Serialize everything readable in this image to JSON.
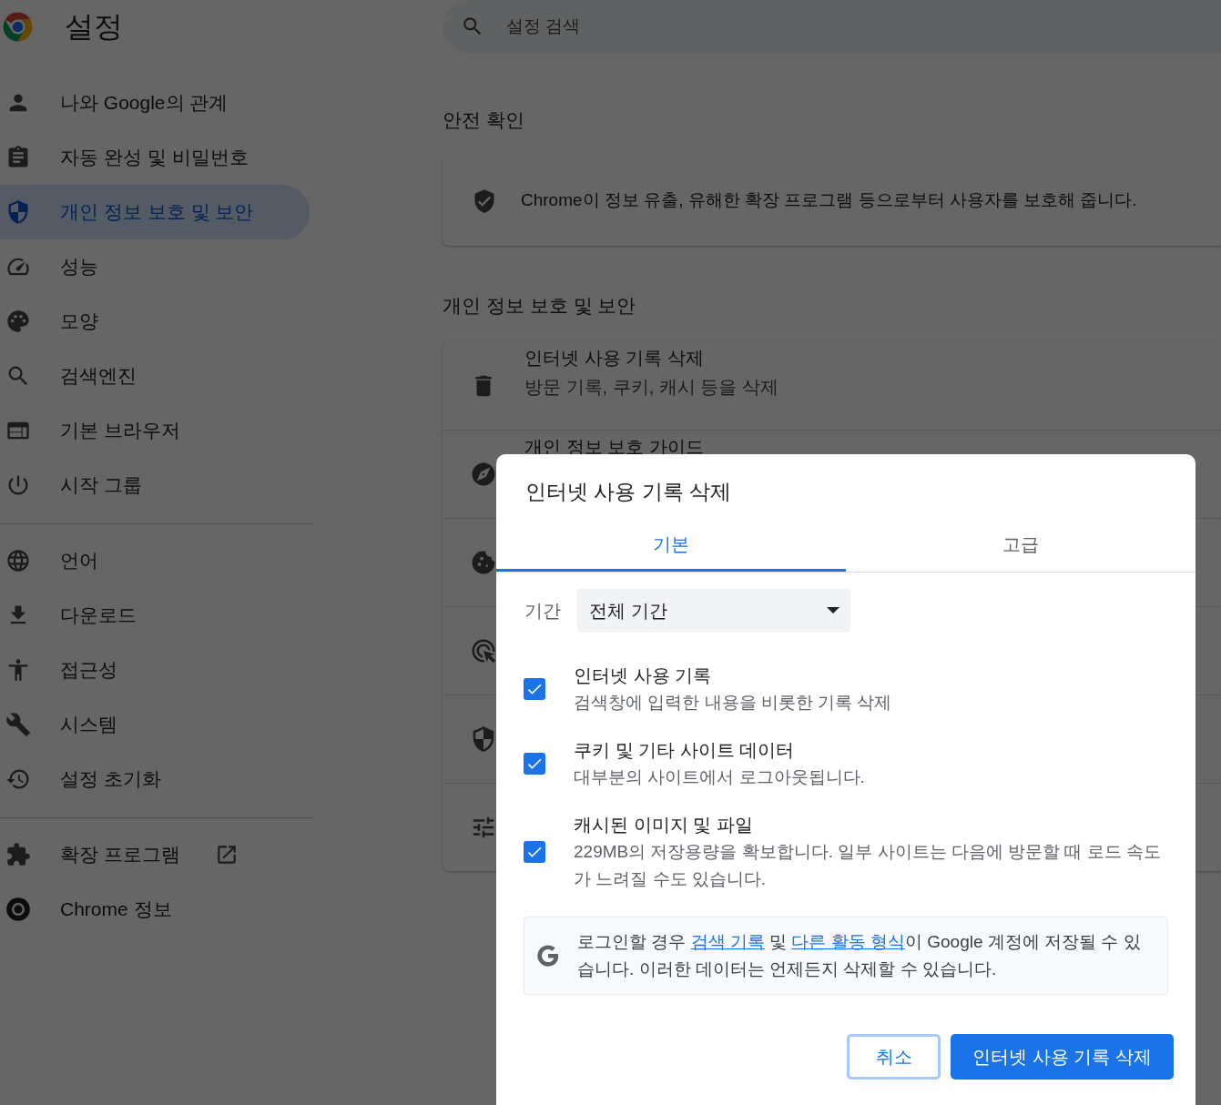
{
  "header": {
    "title": "설정",
    "search_placeholder": "설정 검색"
  },
  "sidebar": {
    "groups": [
      {
        "items": [
          {
            "label": "나와 Google의 관계",
            "selected": false,
            "external_link": false
          },
          {
            "label": "자동 완성 및 비밀번호",
            "selected": false,
            "external_link": false
          },
          {
            "label": "개인 정보 보호 및 보안",
            "selected": true,
            "external_link": false
          },
          {
            "label": "성능",
            "selected": false,
            "external_link": false
          },
          {
            "label": "모양",
            "selected": false,
            "external_link": false
          },
          {
            "label": "검색엔진",
            "selected": false,
            "external_link": false
          },
          {
            "label": "기본 브라우저",
            "selected": false,
            "external_link": false
          },
          {
            "label": "시작 그룹",
            "selected": false,
            "external_link": false
          }
        ]
      },
      {
        "items": [
          {
            "label": "언어",
            "selected": false,
            "external_link": false
          },
          {
            "label": "다운로드",
            "selected": false,
            "external_link": false
          },
          {
            "label": "접근성",
            "selected": false,
            "external_link": false
          },
          {
            "label": "시스템",
            "selected": false,
            "external_link": false
          },
          {
            "label": "설정 초기화",
            "selected": false,
            "external_link": false
          }
        ]
      },
      {
        "items": [
          {
            "label": "확장 프로그램",
            "selected": false,
            "external_link": true
          },
          {
            "label": "Chrome 정보",
            "selected": false,
            "external_link": false
          }
        ]
      }
    ]
  },
  "safety_check": {
    "heading": "안전 확인",
    "text": "Chrome이 정보 유출, 유해한 확장 프로그램 등으로부터 사용자를 보호해 줍니다."
  },
  "privacy": {
    "heading": "개인 정보 보호 및 보안",
    "rows": [
      {
        "title": "인터넷 사용 기록 삭제",
        "subtitle": "방문 기록, 쿠키, 캐시 등을 삭제"
      },
      {
        "title": "개인 정보 보호 가이드"
      },
      {},
      {},
      {},
      {}
    ]
  },
  "dialog": {
    "title": "인터넷 사용 기록 삭제",
    "tabs": [
      {
        "label": "기본",
        "selected": true
      },
      {
        "label": "고급",
        "selected": false
      }
    ],
    "period": {
      "label": "기간",
      "value": "전체 기간"
    },
    "options": [
      {
        "title": "인터넷 사용 기록",
        "description": "검색창에 입력한 내용을 비롯한 기록 삭제",
        "checked": true
      },
      {
        "title": "쿠키 및 기타 사이트 데이터",
        "description": "대부분의 사이트에서 로그아웃됩니다.",
        "checked": true
      },
      {
        "title": "캐시된 이미지 및 파일",
        "description": "229MB의 저장용량을 확보합니다. 일부 사이트는 다음에 방문할 때 로드 속도가 느려질 수도 있습니다.",
        "checked": true
      }
    ],
    "info": [
      {
        "text": "로그인할 경우 ",
        "kind": "text"
      },
      {
        "text": "검색 기록",
        "kind": "link"
      },
      {
        "text": " 및 ",
        "kind": "text"
      },
      {
        "text": "다른 활동 형식",
        "kind": "link"
      },
      {
        "text": "이 Google 계정에 저장될 수 있습니다. 이러한 데이터는 언제든지 삭제할 수 있습니다.",
        "kind": "text"
      }
    ],
    "buttons": [
      {
        "label": "취소",
        "kind": "secondary"
      },
      {
        "label": "인터넷 사용 기록 삭제",
        "kind": "primary"
      }
    ]
  }
}
